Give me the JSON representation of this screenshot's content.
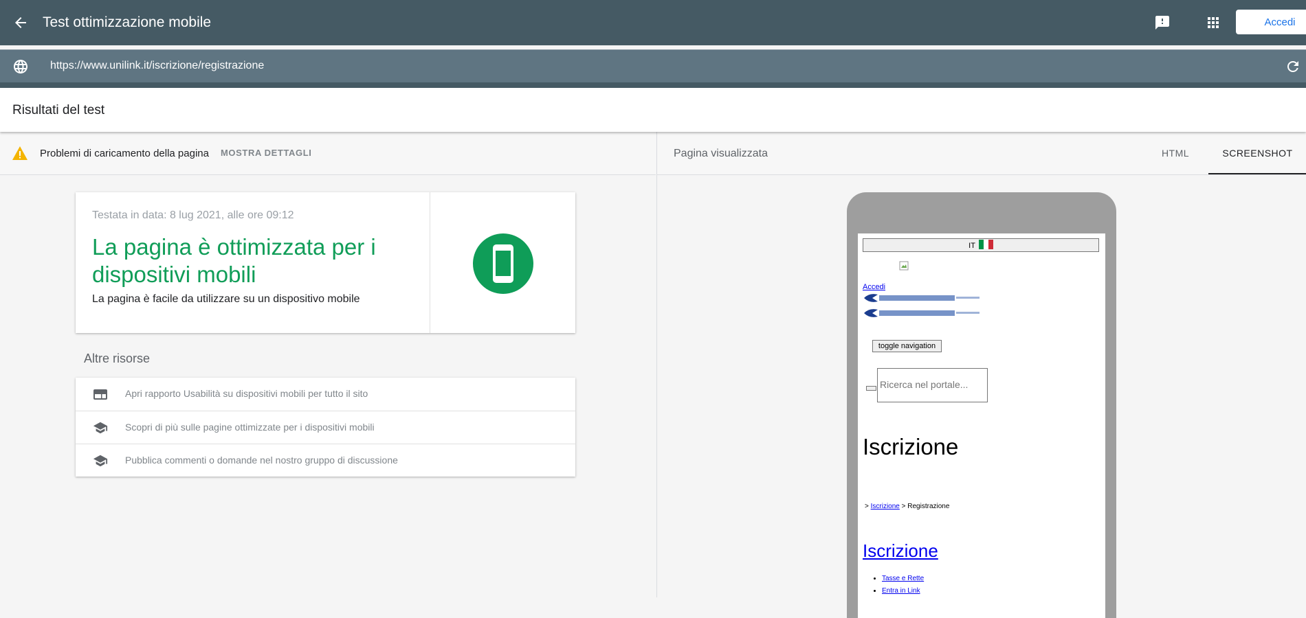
{
  "appbar": {
    "title": "Test ottimizzazione mobile",
    "signin_label": "Accedi",
    "icons": [
      "back-arrow-icon",
      "feedback-icon",
      "apps-grid-icon"
    ]
  },
  "urlbar": {
    "url": "https://www.unilink.it/iscrizione/registrazione",
    "icons": [
      "globe-icon",
      "reload-icon"
    ]
  },
  "results": {
    "title": "Risultati del test"
  },
  "left": {
    "warning": {
      "text": "Problemi di caricamento della pagina",
      "details_label": "MOSTRA DETTAGLI",
      "icon": "warning-icon",
      "icon_color": "#f4b400"
    },
    "card": {
      "date": "Testata in data: 8 lug 2021, alle ore 09:12",
      "verdict": "La pagina è ottimizzata per i dispositivi mobili",
      "subtitle": "La pagina è facile da utilizzare su un dispositivo mobile",
      "verdict_color": "#109d58",
      "badge_icon": "mobile-device-icon"
    },
    "resources": {
      "title": "Altre risorse",
      "items": [
        {
          "label": "Apri rapporto Usabilità su dispositivi mobili per tutto il sito",
          "icon": "web-report-icon"
        },
        {
          "label": "Scopri di più sulle pagine ottimizzate per i dispositivi mobili",
          "icon": "graduation-cap-icon"
        },
        {
          "label": "Pubblica commenti o domande nel nostro gruppo di discussione",
          "icon": "graduation-cap-icon"
        }
      ]
    }
  },
  "right": {
    "title": "Pagina visualizzata",
    "tabs": [
      {
        "label": "HTML",
        "selected": false
      },
      {
        "label": "SCREENSHOT",
        "selected": true
      }
    ],
    "screenshot": {
      "lang_button": "IT",
      "signin_link": "Accedi",
      "toggle_label": "toggle navigation",
      "search_placeholder": "Ricerca nel portale...",
      "heading": "Iscrizione",
      "crumb_prefix": ">",
      "crumb_link": "Iscrizione",
      "crumb_current": "> Registrazione",
      "subheading": "Iscrizione",
      "links": [
        "Tasse e Rette",
        "Entra in Link"
      ]
    }
  }
}
